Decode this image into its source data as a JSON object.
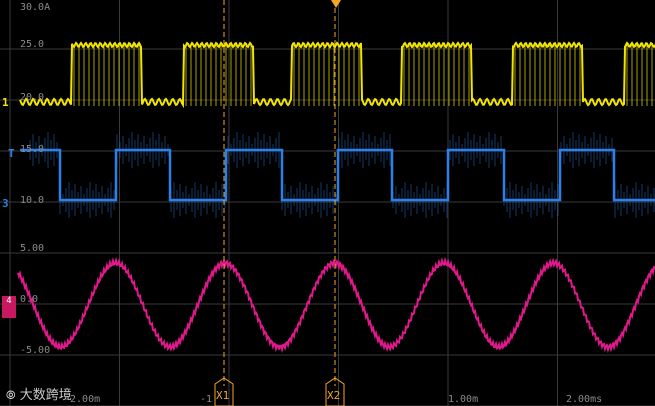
{
  "colors": {
    "ch1": "#f2e500",
    "ch3": "#2e7fe8",
    "ch4": "#e0188c",
    "cursor": "#f4a62a",
    "grid": "#3a3a3a"
  },
  "channels": {
    "ch1": {
      "marker": "1",
      "scale_top": "30.0A",
      "mid": "25.0",
      "zero": "20.0"
    },
    "ch3": {
      "marker": "3",
      "top_level": "15.0",
      "zero": "10.0"
    },
    "ch4": {
      "marker": "4",
      "top": "5.00",
      "mid": "0.0",
      "bottom": "-5.00"
    }
  },
  "trigger": {
    "marker": "T"
  },
  "time_axis": {
    "labels": [
      "-2.00m",
      "-1.",
      "1.00m",
      "2.00ms"
    ]
  },
  "cursors": {
    "x1": {
      "label": "X1"
    },
    "x2": {
      "label": "X2"
    }
  },
  "watermark": {
    "text": "大数跨境"
  }
}
